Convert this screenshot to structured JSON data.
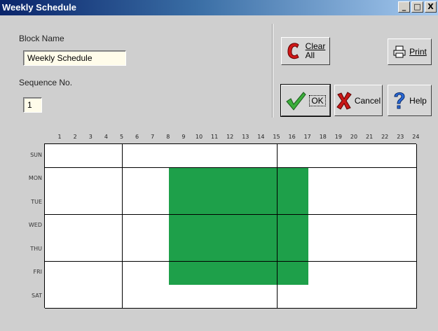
{
  "window": {
    "title": "Weekly Schedule",
    "minimize_label": "_",
    "maximize_label": "□",
    "close_label": "X"
  },
  "form": {
    "block_name_label": "Block Name",
    "block_name_value": "Weekly Schedule",
    "sequence_label": "Sequence No.",
    "sequence_value": "1"
  },
  "buttons": {
    "clear_all_line1": "Clear",
    "clear_all_line2": "All",
    "print": "Print",
    "ok": "OK",
    "cancel": "Cancel",
    "help": "Help"
  },
  "icons": {
    "clear_all": "red-c-icon",
    "print": "printer-icon",
    "ok": "green-checkmark-icon",
    "cancel": "red-x-icon",
    "help": "question-mark-icon"
  },
  "schedule": {
    "hours": [
      "1",
      "2",
      "3",
      "4",
      "5",
      "6",
      "7",
      "8",
      "9",
      "10",
      "11",
      "12",
      "13",
      "14",
      "15",
      "16",
      "17",
      "18",
      "19",
      "20",
      "21",
      "22",
      "23",
      "24"
    ],
    "days": [
      "SUN",
      "MON",
      "TUE",
      "WED",
      "THU",
      "FRI",
      "SAT"
    ],
    "active_color": "#1ea04a",
    "active_days": [
      "MON",
      "TUE",
      "WED",
      "THU",
      "FRI"
    ],
    "active_hours": [
      "9",
      "10",
      "11",
      "12",
      "13",
      "14",
      "15",
      "16",
      "17"
    ]
  }
}
